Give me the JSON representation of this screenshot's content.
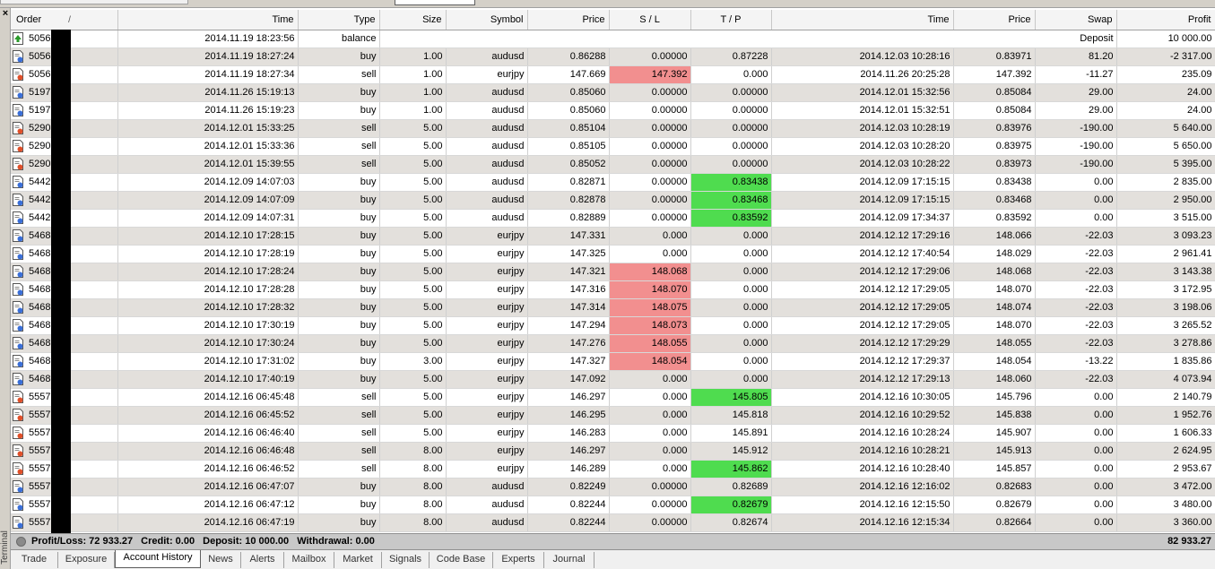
{
  "sidebar": {
    "close_label": "×",
    "vertical_label": "Terminal"
  },
  "columns": [
    {
      "key": "order",
      "label": "Order",
      "sort": "/"
    },
    {
      "key": "time",
      "label": "Time"
    },
    {
      "key": "type",
      "label": "Type"
    },
    {
      "key": "size",
      "label": "Size"
    },
    {
      "key": "symbol",
      "label": "Symbol"
    },
    {
      "key": "price",
      "label": "Price"
    },
    {
      "key": "sl",
      "label": "S / L"
    },
    {
      "key": "tp",
      "label": "T / P"
    },
    {
      "key": "ctime",
      "label": "Time"
    },
    {
      "key": "cprice",
      "label": "Price"
    },
    {
      "key": "swap",
      "label": "Swap"
    },
    {
      "key": "profit",
      "label": "Profit"
    }
  ],
  "balance_row": {
    "order": "50568",
    "time": "2014.11.19 18:23:56",
    "type": "balance",
    "comment": "Deposit",
    "profit": "10 000.00",
    "icon": "deposit-icon"
  },
  "rows": [
    {
      "order": "50569",
      "time": "2014.11.19 18:27:24",
      "type": "buy",
      "size": "1.00",
      "symbol": "audusd",
      "price": "0.86288",
      "sl": "0.00000",
      "tp": "0.87228",
      "ctime": "2014.12.03 10:28:16",
      "cprice": "0.83971",
      "swap": "81.20",
      "profit": "-2 317.00",
      "sl_hl": "",
      "tp_hl": ""
    },
    {
      "order": "50569",
      "time": "2014.11.19 18:27:34",
      "type": "sell",
      "size": "1.00",
      "symbol": "eurjpy",
      "price": "147.669",
      "sl": "147.392",
      "tp": "0.000",
      "ctime": "2014.11.26 20:25:28",
      "cprice": "147.392",
      "swap": "-11.27",
      "profit": "235.09",
      "sl_hl": "red",
      "tp_hl": ""
    },
    {
      "order": "51978",
      "time": "2014.11.26 15:19:13",
      "type": "buy",
      "size": "1.00",
      "symbol": "audusd",
      "price": "0.85060",
      "sl": "0.00000",
      "tp": "0.00000",
      "ctime": "2014.12.01 15:32:56",
      "cprice": "0.85084",
      "swap": "29.00",
      "profit": "24.00",
      "sl_hl": "",
      "tp_hl": ""
    },
    {
      "order": "51978",
      "time": "2014.11.26 15:19:23",
      "type": "buy",
      "size": "1.00",
      "symbol": "audusd",
      "price": "0.85060",
      "sl": "0.00000",
      "tp": "0.00000",
      "ctime": "2014.12.01 15:32:51",
      "cprice": "0.85084",
      "swap": "29.00",
      "profit": "24.00",
      "sl_hl": "",
      "tp_hl": ""
    },
    {
      "order": "52903",
      "time": "2014.12.01 15:33:25",
      "type": "sell",
      "size": "5.00",
      "symbol": "audusd",
      "price": "0.85104",
      "sl": "0.00000",
      "tp": "0.00000",
      "ctime": "2014.12.03 10:28:19",
      "cprice": "0.83976",
      "swap": "-190.00",
      "profit": "5 640.00",
      "sl_hl": "",
      "tp_hl": ""
    },
    {
      "order": "52903",
      "time": "2014.12.01 15:33:36",
      "type": "sell",
      "size": "5.00",
      "symbol": "audusd",
      "price": "0.85105",
      "sl": "0.00000",
      "tp": "0.00000",
      "ctime": "2014.12.03 10:28:20",
      "cprice": "0.83975",
      "swap": "-190.00",
      "profit": "5 650.00",
      "sl_hl": "",
      "tp_hl": ""
    },
    {
      "order": "52903",
      "time": "2014.12.01 15:39:55",
      "type": "sell",
      "size": "5.00",
      "symbol": "audusd",
      "price": "0.85052",
      "sl": "0.00000",
      "tp": "0.00000",
      "ctime": "2014.12.03 10:28:22",
      "cprice": "0.83973",
      "swap": "-190.00",
      "profit": "5 395.00",
      "sl_hl": "",
      "tp_hl": ""
    },
    {
      "order": "54420",
      "time": "2014.12.09 14:07:03",
      "type": "buy",
      "size": "5.00",
      "symbol": "audusd",
      "price": "0.82871",
      "sl": "0.00000",
      "tp": "0.83438",
      "ctime": "2014.12.09 17:15:15",
      "cprice": "0.83438",
      "swap": "0.00",
      "profit": "2 835.00",
      "sl_hl": "",
      "tp_hl": "green"
    },
    {
      "order": "54420",
      "time": "2014.12.09 14:07:09",
      "type": "buy",
      "size": "5.00",
      "symbol": "audusd",
      "price": "0.82878",
      "sl": "0.00000",
      "tp": "0.83468",
      "ctime": "2014.12.09 17:15:15",
      "cprice": "0.83468",
      "swap": "0.00",
      "profit": "2 950.00",
      "sl_hl": "",
      "tp_hl": "green"
    },
    {
      "order": "54420",
      "time": "2014.12.09 14:07:31",
      "type": "buy",
      "size": "5.00",
      "symbol": "audusd",
      "price": "0.82889",
      "sl": "0.00000",
      "tp": "0.83592",
      "ctime": "2014.12.09 17:34:37",
      "cprice": "0.83592",
      "swap": "0.00",
      "profit": "3 515.00",
      "sl_hl": "",
      "tp_hl": "green"
    },
    {
      "order": "54681",
      "time": "2014.12.10 17:28:15",
      "type": "buy",
      "size": "5.00",
      "symbol": "eurjpy",
      "price": "147.331",
      "sl": "0.000",
      "tp": "0.000",
      "ctime": "2014.12.12 17:29:16",
      "cprice": "148.066",
      "swap": "-22.03",
      "profit": "3 093.23",
      "sl_hl": "",
      "tp_hl": ""
    },
    {
      "order": "54681",
      "time": "2014.12.10 17:28:19",
      "type": "buy",
      "size": "5.00",
      "symbol": "eurjpy",
      "price": "147.325",
      "sl": "0.000",
      "tp": "0.000",
      "ctime": "2014.12.12 17:40:54",
      "cprice": "148.029",
      "swap": "-22.03",
      "profit": "2 961.41",
      "sl_hl": "",
      "tp_hl": ""
    },
    {
      "order": "54681",
      "time": "2014.12.10 17:28:24",
      "type": "buy",
      "size": "5.00",
      "symbol": "eurjpy",
      "price": "147.321",
      "sl": "148.068",
      "tp": "0.000",
      "ctime": "2014.12.12 17:29:06",
      "cprice": "148.068",
      "swap": "-22.03",
      "profit": "3 143.38",
      "sl_hl": "red",
      "tp_hl": ""
    },
    {
      "order": "54681",
      "time": "2014.12.10 17:28:28",
      "type": "buy",
      "size": "5.00",
      "symbol": "eurjpy",
      "price": "147.316",
      "sl": "148.070",
      "tp": "0.000",
      "ctime": "2014.12.12 17:29:05",
      "cprice": "148.070",
      "swap": "-22.03",
      "profit": "3 172.95",
      "sl_hl": "red",
      "tp_hl": ""
    },
    {
      "order": "54681",
      "time": "2014.12.10 17:28:32",
      "type": "buy",
      "size": "5.00",
      "symbol": "eurjpy",
      "price": "147.314",
      "sl": "148.075",
      "tp": "0.000",
      "ctime": "2014.12.12 17:29:05",
      "cprice": "148.074",
      "swap": "-22.03",
      "profit": "3 198.06",
      "sl_hl": "red",
      "tp_hl": ""
    },
    {
      "order": "54682",
      "time": "2014.12.10 17:30:19",
      "type": "buy",
      "size": "5.00",
      "symbol": "eurjpy",
      "price": "147.294",
      "sl": "148.073",
      "tp": "0.000",
      "ctime": "2014.12.12 17:29:05",
      "cprice": "148.070",
      "swap": "-22.03",
      "profit": "3 265.52",
      "sl_hl": "red",
      "tp_hl": ""
    },
    {
      "order": "54682",
      "time": "2014.12.10 17:30:24",
      "type": "buy",
      "size": "5.00",
      "symbol": "eurjpy",
      "price": "147.276",
      "sl": "148.055",
      "tp": "0.000",
      "ctime": "2014.12.12 17:29:29",
      "cprice": "148.055",
      "swap": "-22.03",
      "profit": "3 278.86",
      "sl_hl": "red",
      "tp_hl": ""
    },
    {
      "order": "54682",
      "time": "2014.12.10 17:31:02",
      "type": "buy",
      "size": "3.00",
      "symbol": "eurjpy",
      "price": "147.327",
      "sl": "148.054",
      "tp": "0.000",
      "ctime": "2014.12.12 17:29:37",
      "cprice": "148.054",
      "swap": "-13.22",
      "profit": "1 835.86",
      "sl_hl": "red",
      "tp_hl": ""
    },
    {
      "order": "54683",
      "time": "2014.12.10 17:40:19",
      "type": "buy",
      "size": "5.00",
      "symbol": "eurjpy",
      "price": "147.092",
      "sl": "0.000",
      "tp": "0.000",
      "ctime": "2014.12.12 17:29:13",
      "cprice": "148.060",
      "swap": "-22.03",
      "profit": "4 073.94",
      "sl_hl": "",
      "tp_hl": ""
    },
    {
      "order": "55575",
      "time": "2014.12.16 06:45:48",
      "type": "sell",
      "size": "5.00",
      "symbol": "eurjpy",
      "price": "146.297",
      "sl": "0.000",
      "tp": "145.805",
      "ctime": "2014.12.16 10:30:05",
      "cprice": "145.796",
      "swap": "0.00",
      "profit": "2 140.79",
      "sl_hl": "",
      "tp_hl": "green"
    },
    {
      "order": "55575",
      "time": "2014.12.16 06:45:52",
      "type": "sell",
      "size": "5.00",
      "symbol": "eurjpy",
      "price": "146.295",
      "sl": "0.000",
      "tp": "145.818",
      "ctime": "2014.12.16 10:29:52",
      "cprice": "145.838",
      "swap": "0.00",
      "profit": "1 952.76",
      "sl_hl": "",
      "tp_hl": ""
    },
    {
      "order": "55575",
      "time": "2014.12.16 06:46:40",
      "type": "sell",
      "size": "5.00",
      "symbol": "eurjpy",
      "price": "146.283",
      "sl": "0.000",
      "tp": "145.891",
      "ctime": "2014.12.16 10:28:24",
      "cprice": "145.907",
      "swap": "0.00",
      "profit": "1 606.33",
      "sl_hl": "",
      "tp_hl": ""
    },
    {
      "order": "55575",
      "time": "2014.12.16 06:46:48",
      "type": "sell",
      "size": "8.00",
      "symbol": "eurjpy",
      "price": "146.297",
      "sl": "0.000",
      "tp": "145.912",
      "ctime": "2014.12.16 10:28:21",
      "cprice": "145.913",
      "swap": "0.00",
      "profit": "2 624.95",
      "sl_hl": "",
      "tp_hl": ""
    },
    {
      "order": "55575",
      "time": "2014.12.16 06:46:52",
      "type": "sell",
      "size": "8.00",
      "symbol": "eurjpy",
      "price": "146.289",
      "sl": "0.000",
      "tp": "145.862",
      "ctime": "2014.12.16 10:28:40",
      "cprice": "145.857",
      "swap": "0.00",
      "profit": "2 953.67",
      "sl_hl": "",
      "tp_hl": "green"
    },
    {
      "order": "55575",
      "time": "2014.12.16 06:47:07",
      "type": "buy",
      "size": "8.00",
      "symbol": "audusd",
      "price": "0.82249",
      "sl": "0.00000",
      "tp": "0.82689",
      "ctime": "2014.12.16 12:16:02",
      "cprice": "0.82683",
      "swap": "0.00",
      "profit": "3 472.00",
      "sl_hl": "",
      "tp_hl": ""
    },
    {
      "order": "55575",
      "time": "2014.12.16 06:47:12",
      "type": "buy",
      "size": "8.00",
      "symbol": "audusd",
      "price": "0.82244",
      "sl": "0.00000",
      "tp": "0.82679",
      "ctime": "2014.12.16 12:15:50",
      "cprice": "0.82679",
      "swap": "0.00",
      "profit": "3 480.00",
      "sl_hl": "",
      "tp_hl": "green"
    },
    {
      "order": "55575",
      "time": "2014.12.16 06:47:19",
      "type": "buy",
      "size": "8.00",
      "symbol": "audusd",
      "price": "0.82244",
      "sl": "0.00000",
      "tp": "0.82674",
      "ctime": "2014.12.16 12:15:34",
      "cprice": "0.82664",
      "swap": "0.00",
      "profit": "3 360.00",
      "sl_hl": "",
      "tp_hl": ""
    }
  ],
  "summary": {
    "profit_loss": "Profit/Loss: 72 933.27",
    "credit": "Credit: 0.00",
    "deposit": "Deposit: 10 000.00",
    "withdrawal": "Withdrawal: 0.00",
    "total": "82 933.27"
  },
  "tabs": [
    {
      "label": "Trade"
    },
    {
      "label": "Exposure"
    },
    {
      "label": "Account History",
      "active": true
    },
    {
      "label": "News"
    },
    {
      "label": "Alerts"
    },
    {
      "label": "Mailbox"
    },
    {
      "label": "Market"
    },
    {
      "label": "Signals"
    },
    {
      "label": "Code Base"
    },
    {
      "label": "Experts"
    },
    {
      "label": "Journal"
    }
  ],
  "colors": {
    "sl_highlight": "#f28f8f",
    "tp_highlight": "#4fdc4f",
    "alt_row": "#e3e0dc",
    "buy_icon": "#3a6fd8",
    "sell_icon": "#e0502a",
    "deposit_icon": "#2a9a2a"
  }
}
